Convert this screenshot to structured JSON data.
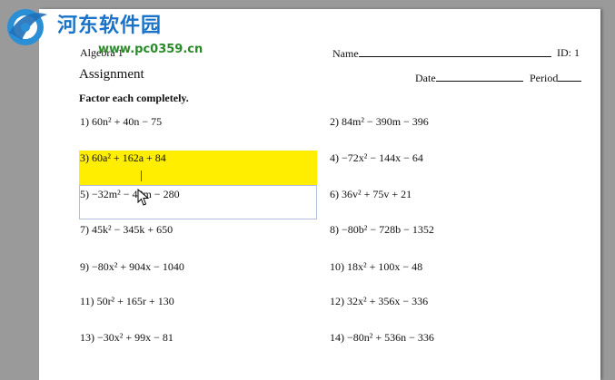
{
  "watermark": {
    "brand": "河东软件园",
    "url": "www.pc0359.cn"
  },
  "worksheet": {
    "course": "Algebra 1",
    "title": "Assignment",
    "name_label": "Name",
    "id_label": "ID: 1",
    "date_label": "Date",
    "period_label": "Period",
    "instructions": "Factor each completely."
  },
  "problems": [
    {
      "num": "1)",
      "expr": "60n² + 40n − 75"
    },
    {
      "num": "2)",
      "expr": "84m² − 390m − 396"
    },
    {
      "num": "3)",
      "expr": "60a² + 162a + 84"
    },
    {
      "num": "4)",
      "expr": "−72x² − 144x − 64"
    },
    {
      "num": "5)",
      "expr": "−32m² − 48m − 280"
    },
    {
      "num": "6)",
      "expr": "36v² + 75v + 21"
    },
    {
      "num": "7)",
      "expr": "45k² − 345k + 650"
    },
    {
      "num": "8)",
      "expr": "−80b² − 728b − 1352"
    },
    {
      "num": "9)",
      "expr": "−80x² + 904x − 1040"
    },
    {
      "num": "10)",
      "expr": "18x² + 100x − 48"
    },
    {
      "num": "11)",
      "expr": "50r² + 165r + 130"
    },
    {
      "num": "12)",
      "expr": "32x² + 356x − 336"
    },
    {
      "num": "13)",
      "expr": "−30x² + 99x − 81"
    },
    {
      "num": "14)",
      "expr": "−80n² + 536n − 336"
    }
  ],
  "colors": {
    "highlight": "#ffee00",
    "page": "#ffffff",
    "background": "#9a9a9a"
  }
}
